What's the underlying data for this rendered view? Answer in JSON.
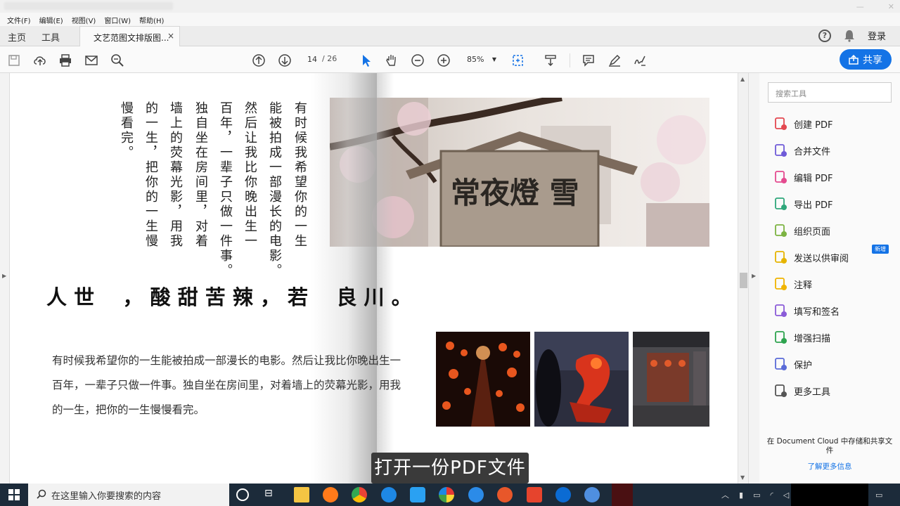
{
  "menubar": {
    "items": [
      "文件(F)",
      "编辑(E)",
      "视图(V)",
      "窗口(W)",
      "帮助(H)"
    ]
  },
  "tabs": {
    "home": "主页",
    "tools": "工具",
    "document": "文艺范图文排版图...",
    "close": "×",
    "login": "登录",
    "help": "?"
  },
  "toolbar": {
    "page_current": "14",
    "page_total": "/ 26",
    "zoom": "85%",
    "share": "共享"
  },
  "document": {
    "vertical_columns": [
      "有时候我希望你的一生",
      "能被拍成一部漫长的电影。",
      "然后让我比你晚出生一",
      "百年，一辈子只做一件事。",
      "独自坐在房间里，对着",
      "墙上的荧幕光影，用我",
      "的一生，把你的一生慢",
      "慢看完。"
    ],
    "headline": "人 世    ， 酸 甜 苦 辣 ， 若    良 川 。",
    "body": "有时候我希望你的一生能被拍成一部漫长的电影。然后让我比你晚出生一百年，一辈子只做一件事。独自坐在房间里，对着墙上的荧幕光影，用我的一生，把你的一生慢慢看完。",
    "sign_text": "常夜燈 雪"
  },
  "caption": "打开一份PDF文件",
  "right_panel": {
    "search_placeholder": "搜索工具",
    "tools": [
      {
        "label": "创建 PDF",
        "icon": "create-pdf-icon",
        "color": "#e34850"
      },
      {
        "label": "合并文件",
        "icon": "combine-files-icon",
        "color": "#6f5bd8"
      },
      {
        "label": "编辑 PDF",
        "icon": "edit-pdf-icon",
        "color": "#e44b8f"
      },
      {
        "label": "导出 PDF",
        "icon": "export-pdf-icon",
        "color": "#2fa77b"
      },
      {
        "label": "组织页面",
        "icon": "organize-pages-icon",
        "color": "#7cb342"
      },
      {
        "label": "发送以供审阅",
        "icon": "send-review-icon",
        "color": "#e6b400"
      },
      {
        "label": "注释",
        "icon": "comment-icon",
        "color": "#f0b400"
      },
      {
        "label": "填写和签名",
        "icon": "fill-sign-icon",
        "color": "#8a5bd8"
      },
      {
        "label": "增强扫描",
        "icon": "enhance-scan-icon",
        "color": "#2ea44f"
      },
      {
        "label": "保护",
        "icon": "protect-icon",
        "color": "#5a6bd8"
      },
      {
        "label": "更多工具",
        "icon": "more-tools-icon",
        "color": "#555555"
      }
    ],
    "new_badge": "新增",
    "cloud_text": "在 Document Cloud 中存储和共享文件",
    "learn_more": "了解更多信息"
  },
  "taskbar": {
    "search_placeholder": "在这里输入你要搜索的内容"
  }
}
